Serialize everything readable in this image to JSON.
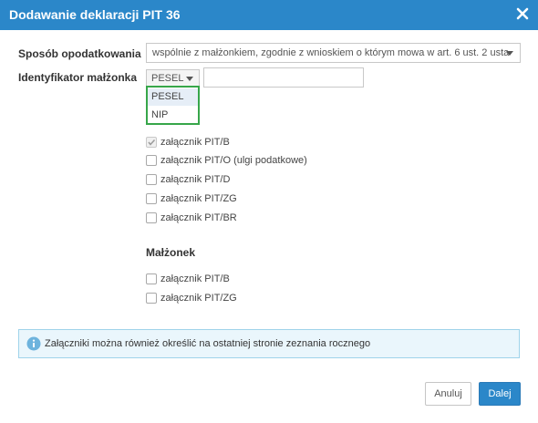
{
  "dialog": {
    "title": "Dodawanie deklaracji PIT 36",
    "close_icon": "close-icon"
  },
  "form": {
    "taxation_label": "Sposób opodatkowania",
    "taxation_value": "wspólnie z małżonkiem, zgodnie z wnioskiem o którym mowa w art. 6 ust. 2 usta",
    "spouse_id_label": "Identyfikator małżonka",
    "spouse_id_type": "PESEL",
    "spouse_id_value": ""
  },
  "dropdown": {
    "options": [
      "PESEL",
      "NIP"
    ],
    "highlighted": "PESEL"
  },
  "attachments": [
    {
      "label": "załącznik PIT/B",
      "checked": true,
      "disabled": true
    },
    {
      "label": "załącznik PIT/O (ulgi podatkowe)",
      "checked": false,
      "disabled": false
    },
    {
      "label": "załącznik PIT/D",
      "checked": false,
      "disabled": false
    },
    {
      "label": "załącznik PIT/ZG",
      "checked": false,
      "disabled": false
    },
    {
      "label": "załącznik PIT/BR",
      "checked": false,
      "disabled": false
    }
  ],
  "spouse_section": {
    "title": "Małżonek",
    "attachments": [
      {
        "label": "załącznik PIT/B",
        "checked": false
      },
      {
        "label": "załącznik PIT/ZG",
        "checked": false
      }
    ]
  },
  "info": {
    "icon": "info-icon",
    "text": "Załączniki można również określić na ostatniej stronie zeznania rocznego"
  },
  "buttons": {
    "cancel": "Anuluj",
    "next": "Dalej"
  },
  "colors": {
    "header": "#2b87c9",
    "dropdown_highlight_border": "#37a64a",
    "info_background": "#eaf6fc",
    "primary_button": "#2b87c9"
  }
}
